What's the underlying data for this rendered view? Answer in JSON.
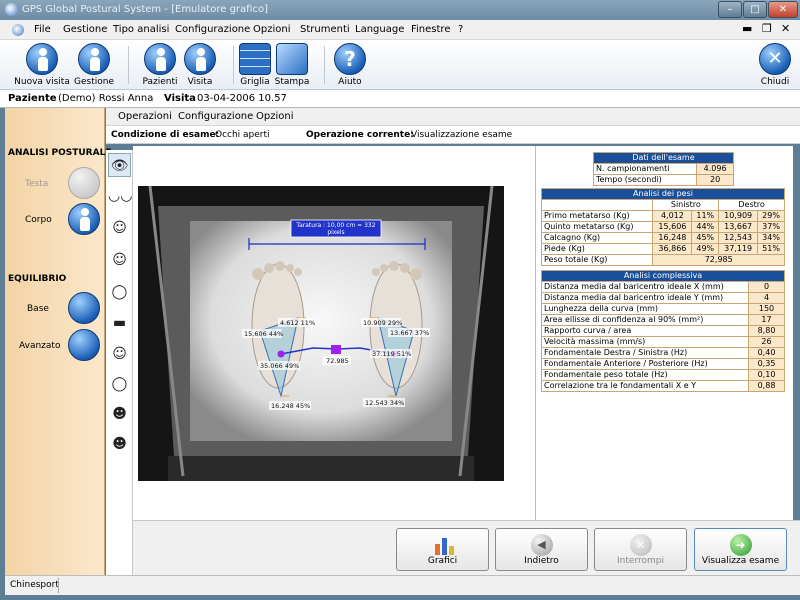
{
  "window": {
    "title": "GPS Global Postural System - [Emulatore grafico]"
  },
  "menu": {
    "items": [
      "File",
      "Gestione",
      "Tipo analisi",
      "Configurazione",
      "Opzioni",
      "Strumenti",
      "Language",
      "Finestre",
      "?"
    ]
  },
  "toolbar": {
    "nuova_visita": "Nuova visita",
    "gestione": "Gestione",
    "pazienti": "Pazienti",
    "visita": "Visita",
    "griglia": "Griglia",
    "stampa": "Stampa",
    "aiuto": "Aiuto",
    "chiudi": "Chiudi"
  },
  "patient": {
    "label": "Paziente",
    "name": "(Demo) Rossi Anna",
    "visit_label": "Visita",
    "visit_date": "03-04-2006 10.57"
  },
  "sidebar": {
    "analisi_header": "ANALISI POSTURALE",
    "testa": "Testa",
    "corpo": "Corpo",
    "equilibrio_header": "EQUILIBRIO",
    "base": "Base",
    "avanzato": "Avanzato"
  },
  "submenu": {
    "items": [
      "Operazioni",
      "Configurazione",
      "Opzioni"
    ]
  },
  "condition": {
    "label": "Condizione di esame:",
    "value": "Occhi aperti",
    "op_label": "Operazione corrente:",
    "op_value": "Visualizzazione esame"
  },
  "calibration": {
    "line1": "Taratura : 10,00 cm = 332",
    "line2": "pixels"
  },
  "overlay": {
    "left_top": "4.612 11%",
    "left_mid": "15.606 44%",
    "left_pivot": "35.066 49%",
    "left_heel": "16.248 45%",
    "right_top": "10.909 29%",
    "right_mid": "13.667 37%",
    "right_pivot": "37.119 51%",
    "right_heel": "12.543 34%",
    "center": "72.985"
  },
  "results": {
    "dati": {
      "title": "Dati dell'esame",
      "rows": [
        {
          "k": "N. campionamenti",
          "v": "4.096"
        },
        {
          "k": "Tempo (secondi)",
          "v": "20"
        }
      ]
    },
    "pesi": {
      "title": "Analisi dei pesi",
      "col_left": "Sinistro",
      "col_right": "Destro",
      "rows": [
        {
          "k": "Primo metatarso (Kg)",
          "l": "4,012",
          "lp": "11%",
          "r": "10,909",
          "rp": "29%"
        },
        {
          "k": "Quinto metatarso (Kg)",
          "l": "15,606",
          "lp": "44%",
          "r": "13,667",
          "rp": "37%"
        },
        {
          "k": "Calcagno (Kg)",
          "l": "16,248",
          "lp": "45%",
          "r": "12,543",
          "rp": "34%"
        },
        {
          "k": "Piede (Kg)",
          "l": "36,866",
          "lp": "49%",
          "r": "37,119",
          "rp": "51%"
        }
      ],
      "total_label": "Peso totale (Kg)",
      "total_value": "72,985"
    },
    "complessiva": {
      "title": "Analisi complessiva",
      "rows": [
        {
          "k": "Distanza media dal baricentro ideale X (mm)",
          "v": "0"
        },
        {
          "k": "Distanza media dal baricentro ideale Y (mm)",
          "v": "4"
        },
        {
          "k": "Lunghezza della curva (mm)",
          "v": "150"
        },
        {
          "k": "Area ellisse di confidenza al 90% (mm²)",
          "v": "17"
        },
        {
          "k": "Rapporto curva / area",
          "v": "8,80"
        },
        {
          "k": "Velocità massima (mm/s)",
          "v": "26"
        },
        {
          "k": "Fondamentale Destra / Sinistra (Hz)",
          "v": "0,40"
        },
        {
          "k": "Fondamentale Anteriore / Posteriore (Hz)",
          "v": "0,35"
        },
        {
          "k": "Fondamentale peso totale (Hz)",
          "v": "0,10"
        },
        {
          "k": "Correlazione tra le fondamentali X e Y",
          "v": "0,88"
        }
      ]
    }
  },
  "bottom": {
    "grafici": "Grafici",
    "indietro": "Indietro",
    "interrompi": "Interrompi",
    "visualizza": "Visualizza esame"
  },
  "status": {
    "text": "Chinesport"
  }
}
